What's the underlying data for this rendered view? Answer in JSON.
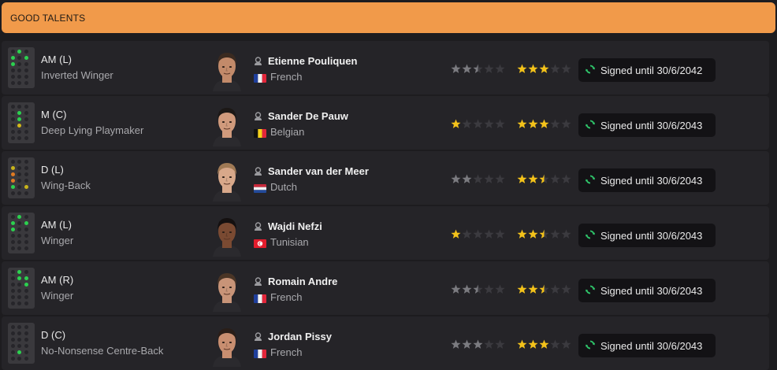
{
  "header": {
    "title": "GOOD TALENTS"
  },
  "colors": {
    "header_bg": "#f19a4a",
    "star_gold": "#f3c21a",
    "star_grey": "#7b7b80",
    "star_empty": "#3b3a3f",
    "renew_icon": "#2fc46a"
  },
  "players": [
    {
      "position": "AM (L)",
      "role": "Inverted Winger",
      "name": "Etienne Pouliquen",
      "nationality": "French",
      "flag": "france",
      "current_ability_stars": 2.5,
      "potential_ability_stars": 3,
      "potential_star_color": "gold",
      "current_star_color": "grey",
      "contract": "Signed until 30/6/2042",
      "contract_icon": "renew-icon",
      "pitch_dots": [
        "aml"
      ],
      "skin": "#c28a6a",
      "hair": "#3a2a20"
    },
    {
      "position": "M (C)",
      "role": "Deep Lying Playmaker",
      "name": "Sander De Pauw",
      "nationality": "Belgian",
      "flag": "belgium",
      "current_ability_stars": 1,
      "potential_ability_stars": 3,
      "potential_star_color": "gold",
      "current_star_color": "gold",
      "contract": "Signed until 30/6/2043",
      "contract_icon": "renew-icon",
      "pitch_dots": [
        "mc"
      ],
      "skin": "#d09a7c",
      "hair": "#1c1816"
    },
    {
      "position": "D (L)",
      "role": "Wing-Back",
      "name": "Sander van der Meer",
      "nationality": "Dutch",
      "flag": "netherlands",
      "current_ability_stars": 2,
      "potential_ability_stars": 2.5,
      "potential_star_color": "gold",
      "current_star_color": "grey",
      "contract": "Signed until 30/6/2043",
      "contract_icon": "renew-icon",
      "pitch_dots": [
        "dl"
      ],
      "skin": "#d8a88a",
      "hair": "#a07a55"
    },
    {
      "position": "AM (L)",
      "role": "Winger",
      "name": "Wajdi Nefzi",
      "nationality": "Tunisian",
      "flag": "tunisia",
      "current_ability_stars": 1,
      "potential_ability_stars": 2.5,
      "potential_star_color": "gold",
      "current_star_color": "gold",
      "contract": "Signed until 30/6/2043",
      "contract_icon": "renew-icon",
      "pitch_dots": [
        "aml"
      ],
      "skin": "#7a4a32",
      "hair": "#141010"
    },
    {
      "position": "AM (R)",
      "role": "Winger",
      "name": "Romain Andre",
      "nationality": "French",
      "flag": "france",
      "current_ability_stars": 2.5,
      "potential_ability_stars": 2.5,
      "potential_star_color": "gold",
      "current_star_color": "grey",
      "contract": "Signed until 30/6/2043",
      "contract_icon": "renew-icon",
      "pitch_dots": [
        "amr"
      ],
      "skin": "#c89478",
      "hair": "#4a3526"
    },
    {
      "position": "D (C)",
      "role": "No-Nonsense Centre-Back",
      "name": "Jordan Pissy",
      "nationality": "French",
      "flag": "france",
      "current_ability_stars": 3,
      "potential_ability_stars": 3,
      "potential_star_color": "gold",
      "current_star_color": "grey",
      "contract": "Signed until 30/6/2043",
      "contract_icon": "renew-icon",
      "pitch_dots": [
        "dc"
      ],
      "skin": "#c88e70",
      "hair": "#2a1e18"
    }
  ]
}
